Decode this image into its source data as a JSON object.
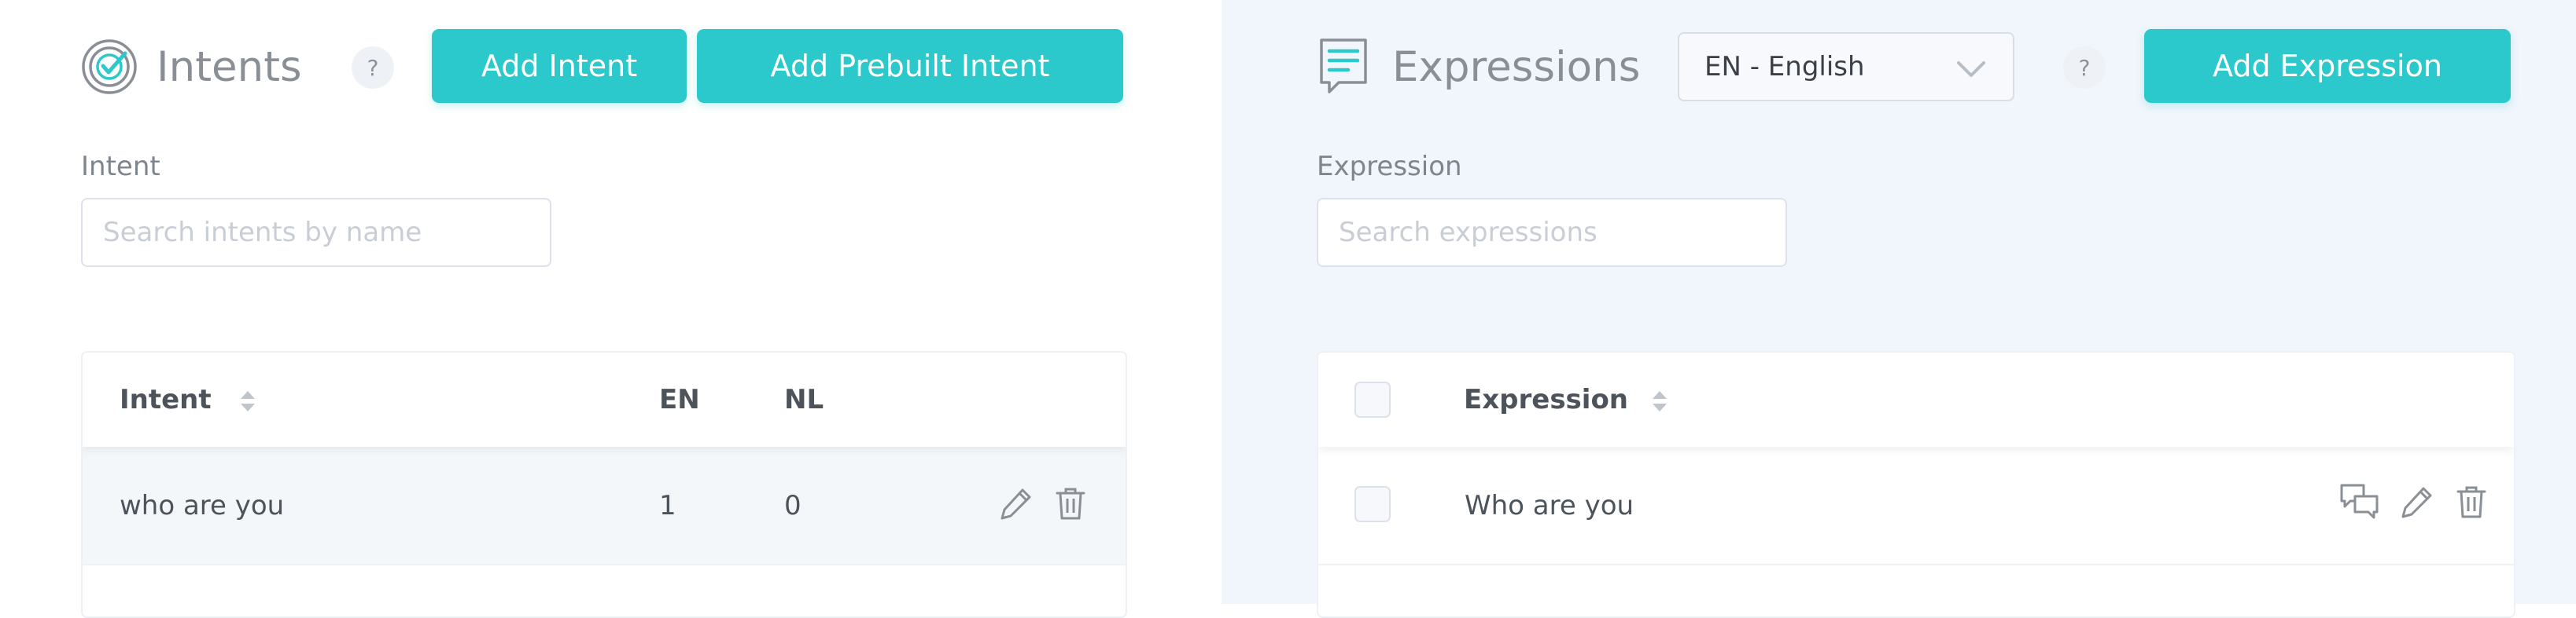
{
  "intents_panel": {
    "title": "Intents",
    "help_label": "?",
    "add_intent_label": "Add Intent",
    "add_prebuilt_label": "Add Prebuilt Intent",
    "filter_label": "Intent",
    "search_placeholder": "Search intents by name",
    "columns": [
      "Intent",
      "EN",
      "NL"
    ],
    "rows": [
      {
        "intent": "who are you",
        "en": "1",
        "nl": "0"
      }
    ]
  },
  "expressions_panel": {
    "title": "Expressions",
    "language_select": "EN - English",
    "help_label": "?",
    "add_expression_label": "Add Expression",
    "filter_label": "Expression",
    "search_placeholder": "Search expressions",
    "columns": [
      "Expression"
    ],
    "rows": [
      {
        "expression": "Who are you"
      }
    ]
  },
  "icons": {
    "intents_logo": "target-check-icon",
    "expressions_logo": "document-speech-icon",
    "sort": "sort-arrows-icon",
    "edit": "pencil-icon",
    "delete": "trash-icon",
    "chat": "chat-bubbles-icon",
    "dropdown": "chevron-down-icon"
  },
  "colors": {
    "accent": "#2bc9cc",
    "right_panel_bg": "#f1f5fc",
    "title_gray": "#8a8f96"
  }
}
